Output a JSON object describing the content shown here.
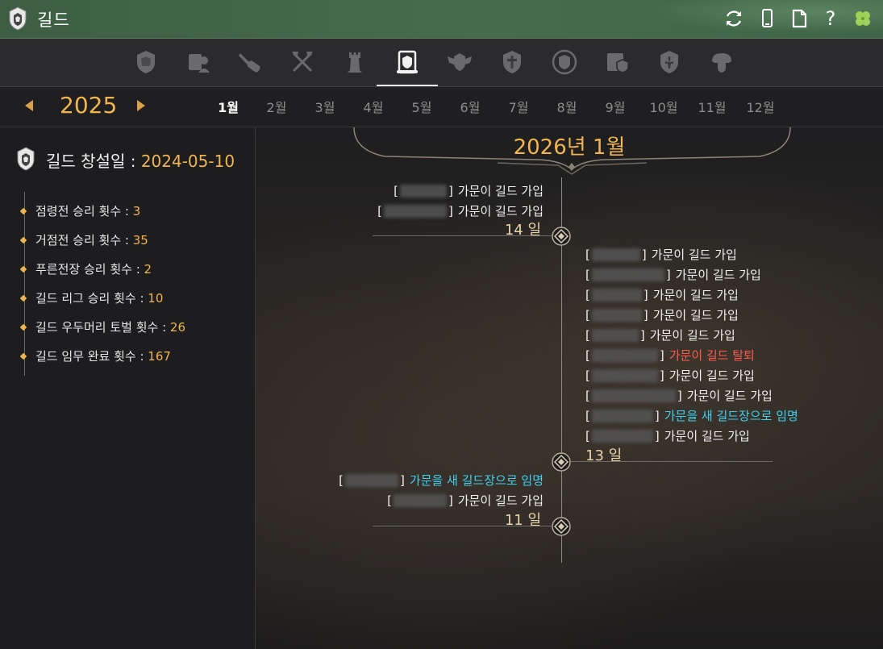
{
  "window": {
    "title": "길드"
  },
  "toolbar": {
    "icons": [
      "refresh-icon",
      "phone-icon",
      "document-icon",
      "help-icon",
      "clover-icon"
    ],
    "help_label": "?"
  },
  "tabs": [
    {
      "icon": "guild-crest-icon",
      "active": false
    },
    {
      "icon": "scroll-person-icon",
      "active": false
    },
    {
      "icon": "sword-scroll-icon",
      "active": false
    },
    {
      "icon": "crossed-axes-icon",
      "active": false
    },
    {
      "icon": "tower-icon",
      "active": false
    },
    {
      "icon": "scroll-crest-icon",
      "active": true
    },
    {
      "icon": "winged-crest-icon",
      "active": false
    },
    {
      "icon": "shield-sword-icon",
      "active": false
    },
    {
      "icon": "round-crest-icon",
      "active": false
    },
    {
      "icon": "scroll-document-icon",
      "active": false
    },
    {
      "icon": "fleur-shield-icon",
      "active": false
    },
    {
      "icon": "helmet-crest-icon",
      "active": false
    }
  ],
  "calendar": {
    "year": "2025",
    "months": [
      "1월",
      "2월",
      "3월",
      "4월",
      "5월",
      "6월",
      "7월",
      "8월",
      "9월",
      "10월",
      "11월",
      "12월"
    ],
    "active_month_index": 0
  },
  "guild": {
    "founded_label": "길드 창설일 : ",
    "founded_date": "2024-05-10",
    "stats": [
      {
        "label": "점령전 승리 횟수 : ",
        "value": "3"
      },
      {
        "label": "거점전 승리 횟수 : ",
        "value": "35"
      },
      {
        "label": "푸른전장 승리 횟수 : ",
        "value": "2"
      },
      {
        "label": "길드 리그 승리 횟수 : ",
        "value": "10"
      },
      {
        "label": "길드 우두머리 토벌 횟수 : ",
        "value": "26"
      },
      {
        "label": "길드 임무 완료 횟수 : ",
        "value": "167"
      }
    ]
  },
  "timeline": {
    "title": "2026년 1월",
    "days": [
      {
        "label": "14 일",
        "side": "left",
        "events": [
          {
            "text": "가문이 길드 가입",
            "type": "join"
          },
          {
            "text": "가문이 길드 가입",
            "type": "join"
          }
        ]
      },
      {
        "label": "13 일",
        "side": "right",
        "events": [
          {
            "text": "가문이 길드 가입",
            "type": "join"
          },
          {
            "text": "가문이 길드 가입",
            "type": "join"
          },
          {
            "text": "가문이 길드 가입",
            "type": "join"
          },
          {
            "text": "가문이 길드 가입",
            "type": "join"
          },
          {
            "text": "가문이 길드 가입",
            "type": "join"
          },
          {
            "text": "가문이 길드 탈퇴",
            "type": "leave"
          },
          {
            "text": "가문이 길드 가입",
            "type": "join"
          },
          {
            "text": "가문이 길드 가입",
            "type": "join"
          },
          {
            "text": "가문을 새 길드장으로 임명",
            "type": "leader"
          },
          {
            "text": "가문이 길드 가입",
            "type": "join"
          }
        ]
      },
      {
        "label": "11 일",
        "side": "left",
        "events": [
          {
            "text": "가문을 새 길드장으로 임명",
            "type": "leader"
          },
          {
            "text": "가문이 길드 가입",
            "type": "join"
          }
        ]
      }
    ],
    "colors": {
      "join": "#f0f0f0",
      "leave": "#ff5a4f",
      "leader": "#3fd0ef",
      "accent": "#f0b54e"
    }
  }
}
